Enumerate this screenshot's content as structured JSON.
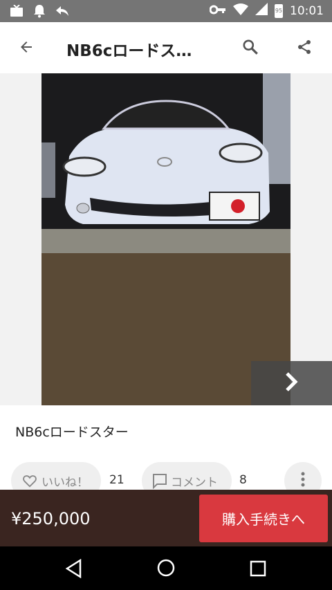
{
  "status_bar": {
    "time": "10:01",
    "battery_level": "95",
    "icons": [
      "tv-icon",
      "bell-icon",
      "reply-icon",
      "key-icon",
      "wifi-icon",
      "signal-icon",
      "battery-icon"
    ]
  },
  "app_bar": {
    "title": "NB6cロードス…",
    "back_icon": "arrow-left-icon",
    "search_icon": "search-icon",
    "share_icon": "share-icon"
  },
  "item": {
    "title": "NB6cロードスター",
    "photo_description": "white roadster car photo",
    "next_icon": "chevron-right-icon"
  },
  "actions": {
    "like_label": "いいね！",
    "like_count": "21",
    "comment_label": "コメント",
    "comment_count": "8",
    "more_icon": "more-vertical-icon"
  },
  "purchase": {
    "price": "¥250,000",
    "buy_label": "購入手続きへ"
  },
  "colors": {
    "status_bar": "#757575",
    "bottom_bar": "#3a2520",
    "buy_button": "#d9393f"
  }
}
